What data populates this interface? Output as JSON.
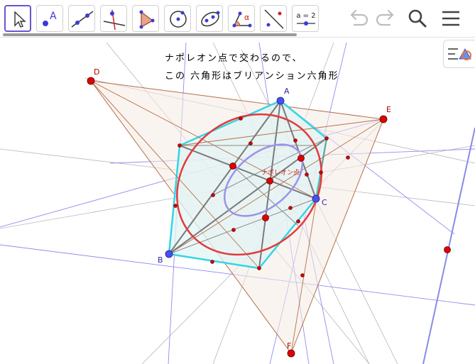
{
  "toolbar": {
    "tools": [
      {
        "name": "move-tool",
        "icon": "cursor-arrow-icon",
        "selected": true
      },
      {
        "name": "point-tool",
        "icon": "point-A-icon",
        "label": "A"
      },
      {
        "name": "line-tool",
        "icon": "line-through-points-icon"
      },
      {
        "name": "perpendicular-tool",
        "icon": "perpendicular-line-icon"
      },
      {
        "name": "polygon-tool",
        "icon": "polygon-icon"
      },
      {
        "name": "circle-tool",
        "icon": "circle-center-point-icon"
      },
      {
        "name": "conic-tool",
        "icon": "ellipse-icon"
      },
      {
        "name": "angle-tool",
        "icon": "angle-alpha-icon",
        "label": "α"
      },
      {
        "name": "reflect-tool",
        "icon": "reflect-about-line-icon"
      },
      {
        "name": "slider-tool",
        "icon": "slider-icon",
        "label": "a = 2"
      }
    ],
    "undo": "undo-icon",
    "redo": "redo-icon",
    "search": "search-icon",
    "menu": "hamburger-menu-icon"
  },
  "caption": {
    "line1": "ナポレオン点で交わるので、",
    "line2": "この 六角形はブリアンション六角形"
  },
  "labels": {
    "A": "A",
    "B": "B",
    "C": "C",
    "D": "D",
    "E": "E",
    "F": "F",
    "napoleon": "ナポレオン点"
  },
  "algebra_toggle": {
    "icon": "algebra-view-toggle-icon"
  },
  "colors": {
    "triangle_point": "#4b4ff0",
    "construction_point": "#e10000",
    "hexagon": "#33d6e6",
    "ellipse_outer": "#e23b3b",
    "ellipse_inner": "#9a92ec",
    "outer_triangle": "#b5704a",
    "selection": "#6557d2"
  }
}
